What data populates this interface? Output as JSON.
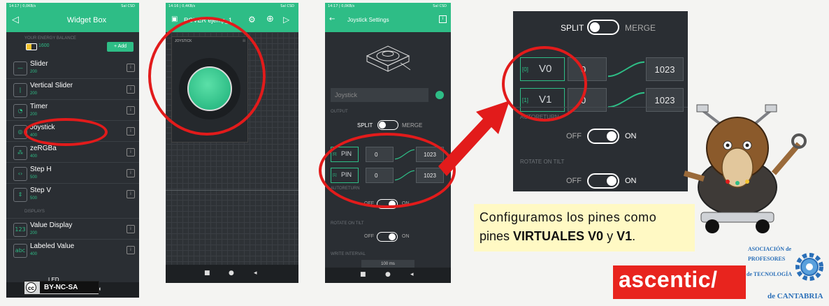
{
  "phone1": {
    "status_time": "14:17 | 0,0KB/s",
    "status_signal": "Sal CSD",
    "title": "Widget Box",
    "energy_label": "YOUR ENERGY BALANCE",
    "energy_value": "1600",
    "add_label": "+ Add",
    "widgets": [
      {
        "name": "Slider",
        "price": "200",
        "icon": "—"
      },
      {
        "name": "Vertical Slider",
        "price": "200",
        "icon": "|"
      },
      {
        "name": "Timer",
        "price": "200",
        "icon": "◔"
      },
      {
        "name": "Joystick",
        "price": "400",
        "icon": "◎"
      },
      {
        "name": "zeRGBa",
        "price": "400",
        "icon": "⁂"
      },
      {
        "name": "Step H",
        "price": "500",
        "icon": "‹›"
      },
      {
        "name": "Step V",
        "price": "500",
        "icon": "⇕"
      }
    ],
    "displays_label": "DISPLAYS",
    "displays": [
      {
        "name": "Value Display",
        "price": "200",
        "icon": "123"
      },
      {
        "name": "Labeled Value",
        "price": "400",
        "icon": "abc"
      }
    ],
    "partial_item": "LED"
  },
  "phone2": {
    "status_time": "14:16 | 0,4KB/s",
    "status_signal": "Sal CSD",
    "title": "ROVER ejemp_1",
    "widget_label": "JOYSTICK"
  },
  "phone3": {
    "status_time": "14:17 | 0,0KB/s",
    "status_signal": "Sal CSD",
    "title": "Joystick Settings",
    "name_value": "Joystick",
    "output_label": "OUTPUT",
    "split_label": "SPLIT",
    "merge_label": "MERGE",
    "pins": [
      {
        "idx": "[0]",
        "label": "PIN",
        "min": "0",
        "max": "1023"
      },
      {
        "idx": "[1]",
        "label": "PIN",
        "min": "0",
        "max": "1023"
      }
    ],
    "autoreturn_label": "AUTORETURN",
    "autoreturn_off": "OFF",
    "autoreturn_on": "ON",
    "rotate_label": "ROTATE ON TILT",
    "rotate_off": "OFF",
    "rotate_on": "ON",
    "write_label": "WRITE INTERVAL",
    "write_value": "100 ms"
  },
  "zoom": {
    "split_label": "SPLIT",
    "merge_label": "MERGE",
    "pins": [
      {
        "idx": "[0]",
        "label": "V0",
        "min": "0",
        "max": "1023"
      },
      {
        "idx": "[1]",
        "label": "V1",
        "min": "0",
        "max": "1023"
      }
    ],
    "autoreturn_label": "AUTORETURN",
    "autoreturn_off": "OFF",
    "autoreturn_on": "ON",
    "rotate_label": "ROTATE ON TILT",
    "rotate_off": "OFF",
    "rotate_on": "ON"
  },
  "caption": {
    "line1": "Configuramos los pines como",
    "line2_prefix": "pines ",
    "line2_bold1": "VIRTUALES V0",
    "line2_mid": " y ",
    "line2_bold2": "V1",
    "line2_suffix": "."
  },
  "license": {
    "cc": "cc",
    "text": "BY-NC-SA"
  },
  "brand": {
    "ascentic": "ascentic/"
  },
  "association": {
    "line1": "ASOCIACIÓN de",
    "line2": "PROFESORES",
    "line3": "de TECNOLOGÍA",
    "line4": "de CANTABRIA"
  },
  "colors": {
    "accent": "#2ebd86",
    "highlight": "#e21b1b",
    "caption_bg": "#fff9c4"
  }
}
